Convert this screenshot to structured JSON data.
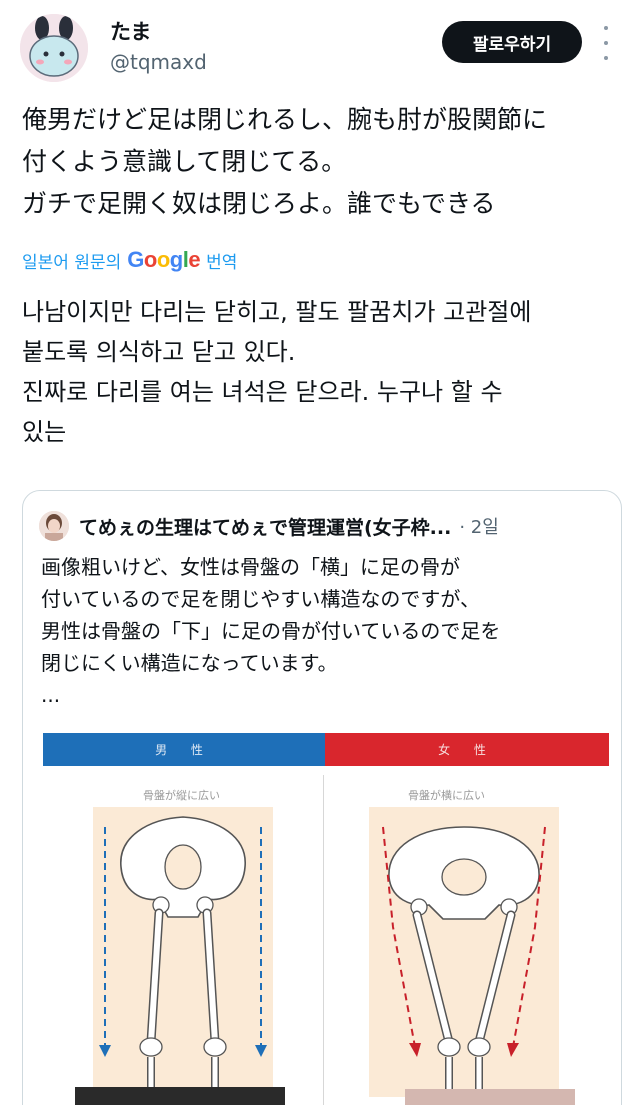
{
  "user": {
    "name": "たま",
    "handle": "@tqmaxd",
    "follow_label": "팔로우하기"
  },
  "tweet": {
    "original_lines": [
      "俺男だけど足は閉じれるし、腕も肘が股関節に",
      "付くよう意識して閉じてる。",
      "ガチで足開く奴は閉じろよ。誰でもできる"
    ],
    "translate_prefix": "일본어 원문의",
    "translate_google": "Google",
    "translate_suffix": "번역",
    "translated_lines": [
      "나남이지만 다리는 닫히고, 팔도 팔꿈치가 고관절에",
      "붙도록 의식하고 닫고 있다.",
      "진짜로 다리를 여는 녀석은 닫으라. 누구나 할 수",
      "있는"
    ]
  },
  "quote": {
    "name": "てめぇの生理はてめぇで管理運営(女子枠...",
    "meta": "· 2일",
    "lines": [
      "画像粗いけど、女性は骨盤の「横」に足の骨が",
      "付いているので足を閉じやすい構造なのですが、",
      "男性は骨盤の「下」に足の骨が付いているので足を",
      "閉じにくい構造になっています。",
      "..."
    ],
    "image": {
      "male_label": "男 性",
      "female_label": "女 性",
      "male_caption": "骨盤が縦に広い",
      "female_caption": "骨盤が横に広い"
    }
  },
  "colors": {
    "accent_link": "#1d9bf0",
    "male_band": "#1e6fb8",
    "female_band": "#d9262d",
    "follow_button": "#0f1419"
  },
  "icons": {
    "more": "more-vertical-icon",
    "avatar": "user-avatar-image",
    "quote_avatar": "quote-avatar-image"
  }
}
